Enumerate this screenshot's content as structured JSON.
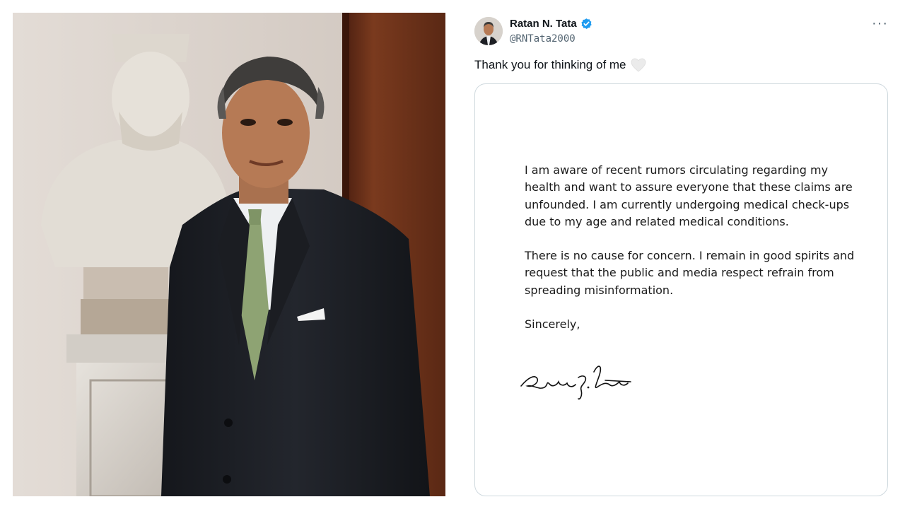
{
  "tweet": {
    "display_name": "Ratan N. Tata",
    "handle": "@RNTata2000",
    "text": "Thank you for thinking of me",
    "emoji_icon": "white-heart-icon",
    "verified_icon": "verified-badge-icon",
    "more_icon": "more-options-icon",
    "more_label": "···",
    "accent_color": "#1d9bf0"
  },
  "letter": {
    "paragraph_1": "I am aware of recent rumors circulating regarding my health and want to assure everyone that these claims are unfounded. I am currently undergoing medical check-ups due to my age and related medical conditions.",
    "paragraph_2": "There is no cause for concern. I remain in good spirits and request that the public and media respect refrain from spreading misinformation.",
    "closing": "Sincerely,",
    "signature": "Ratan N. Tata"
  }
}
